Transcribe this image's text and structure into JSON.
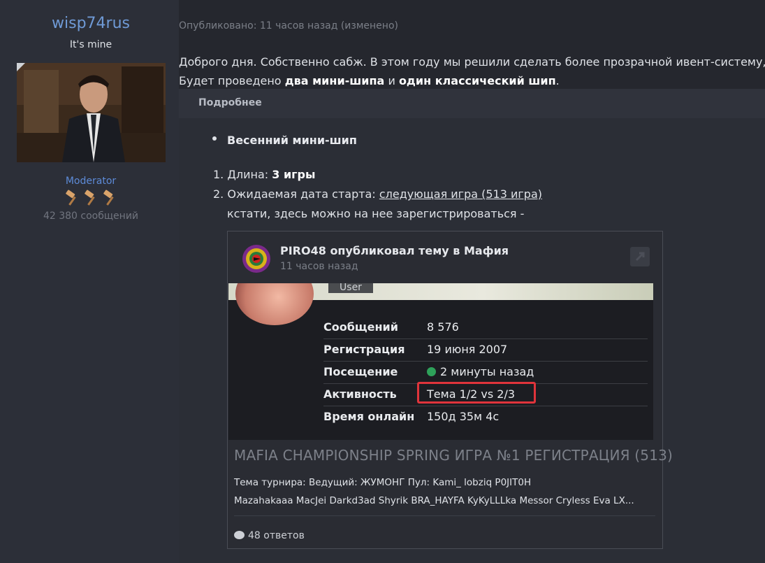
{
  "user": {
    "name": "wisp74rus",
    "title": "It's mine",
    "role": "Moderator",
    "message_count": "42 380 сообщений"
  },
  "post": {
    "meta": "Опубликовано: 11 часов назад (изменено)",
    "line1": "Доброго дня. Собственно сабж. В этом году мы решили сделать более прозрачной ивент-систему, и вот",
    "line2_prefix": "Будет проведено ",
    "line2_bold1": "два мини-шипа",
    "line2_mid": "  и ",
    "line2_bold2": "один классический шип",
    "line2_end": ".",
    "spoiler_label": "Подробнее",
    "bullet": "Весенний мини-шип",
    "item1_label": "Длина: ",
    "item1_value": "3 игры",
    "item2_label": "Ожидаемая дата старта: ",
    "item2_link": "следующая игра (513 игра)",
    "item2_note": "кстати, здесь можно на нее зарегистрироваться -"
  },
  "embed": {
    "title": "PIRO48 опубликовал тему в Мафия",
    "time": "11 часов назад",
    "badge": "User",
    "rows": [
      {
        "label": "Сообщений",
        "value": "8 576"
      },
      {
        "label": "Регистрация",
        "value": "19 июня 2007"
      },
      {
        "label": "Посещение",
        "value": "2 минуты назад"
      },
      {
        "label": "Активность",
        "value": "Тема 1/2 vs 2/3"
      },
      {
        "label": "Время онлайн",
        "value": "150д 35м 4с"
      }
    ],
    "topic_title": "MAFIA CHAMPIONSHIP SPRING ИГРА №1 РЕГИСТРАЦИЯ (513)",
    "topic_desc1": "Тема турнира:  Ведущий:  ЖУМОНГ   Пул: Kami_ lobziq P0JIT0H",
    "topic_desc2": "Mazahakaaa MacJei Darkd3ad Shyrik BRA_HAYFA KyKyLLLka Messor Cryless Eva LX...",
    "replies": "48 ответов"
  },
  "colors": {
    "username": "#6f9ad6",
    "role": "#5d8bd8",
    "highlight": "#e0343b",
    "online": "#2ea15a"
  }
}
